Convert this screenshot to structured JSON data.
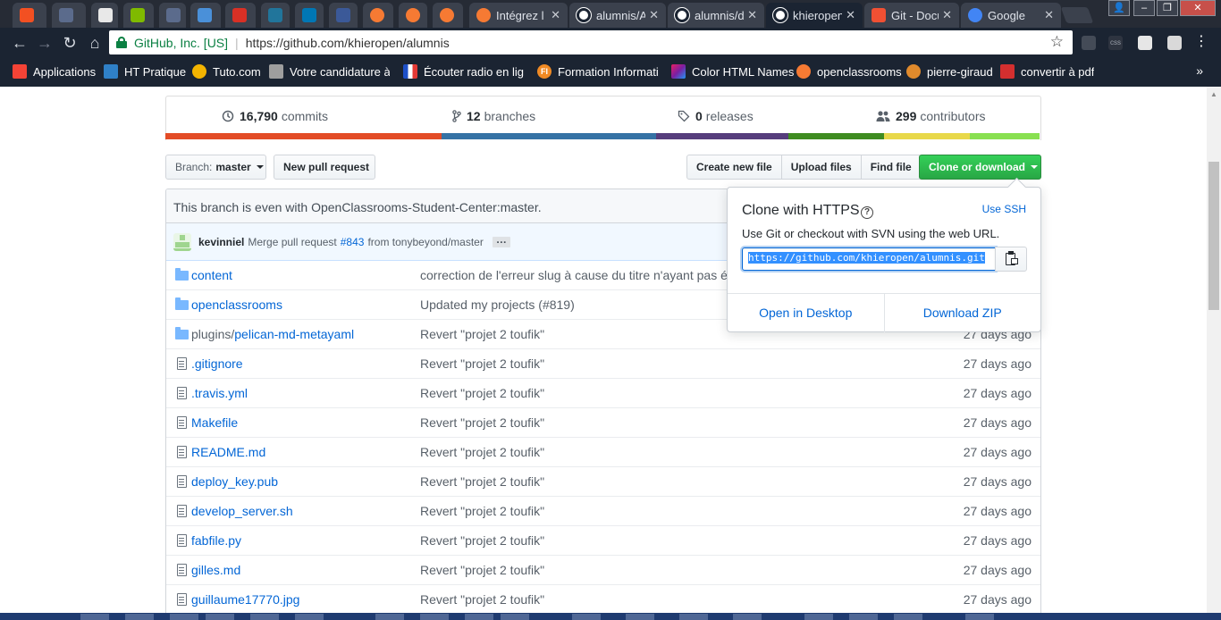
{
  "browser": {
    "tabs": [
      {
        "icon": "microsoft-icon",
        "label": "",
        "color": "#f25022"
      },
      {
        "icon": "settings-icon",
        "label": "",
        "color": "#5b6b8c"
      },
      {
        "icon": "text-icon",
        "label": "",
        "color": "#e8e8e8"
      },
      {
        "icon": "microsoft-icon",
        "label": "",
        "color": "#7fba00"
      },
      {
        "icon": "refresh-icon",
        "label": "",
        "color": "#5b6b8c"
      },
      {
        "icon": "kr-icon",
        "label": "",
        "color": "#4a90d9"
      },
      {
        "icon": "gmail-icon",
        "label": "",
        "color": "#d93025"
      },
      {
        "icon": "wordpress-icon",
        "label": "",
        "color": "#21759b"
      },
      {
        "icon": "linkedin-icon",
        "label": "",
        "color": "#0077b5"
      },
      {
        "icon": "facebook-icon",
        "label": "",
        "color": "#3b5998"
      },
      {
        "icon": "openclassrooms-icon",
        "label": "",
        "color": "#f67a33"
      },
      {
        "icon": "openclassrooms-icon",
        "label": "",
        "color": "#f67a33"
      },
      {
        "icon": "openclassrooms-icon",
        "label": "",
        "color": "#f67a33"
      },
      {
        "icon": "openclassrooms-icon",
        "label": "Intégrez l",
        "color": "#f67a33"
      },
      {
        "icon": "github-icon",
        "label": "alumnis/A",
        "color": "#ffffff"
      },
      {
        "icon": "github-icon",
        "label": "alumnis/d",
        "color": "#ffffff"
      },
      {
        "icon": "github-icon",
        "label": "khieropen",
        "color": "#ffffff"
      },
      {
        "icon": "git-icon",
        "label": "Git - Docu",
        "color": "#f05033"
      },
      {
        "icon": "google-icon",
        "label": "Google",
        "color": "#4285f4"
      }
    ],
    "active_tab_index": 16,
    "secure_org": "GitHub, Inc. [US]",
    "url_separator": "|",
    "url": "https://github.com/khieropen/alumnis",
    "bookmarks": [
      {
        "icon": "apps-grid-icon",
        "label": "Applications",
        "color": "#f44336"
      },
      {
        "icon": "ht-pratique-icon",
        "label": "HT Pratique",
        "color": "#2f80c7"
      },
      {
        "icon": "tuto-icon",
        "label": "Tuto.com",
        "color": "#f4b400"
      },
      {
        "icon": "document-icon",
        "label": "Votre candidature à l'",
        "color": "#9e9e9e"
      },
      {
        "icon": "france-flag-icon",
        "label": "Écouter radio en ligne",
        "color": "#1e50c8"
      },
      {
        "icon": "fi-icon",
        "label": "Formation Informatiq",
        "color": "#f08a24"
      },
      {
        "icon": "color-html-icon",
        "label": "Color HTML Names",
        "color": "#7b1fa2"
      },
      {
        "icon": "openclassrooms-icon",
        "label": "openclassrooms",
        "color": "#f67a33"
      },
      {
        "icon": "pierre-giraud-icon",
        "label": "pierre-giraud",
        "color": "#e08a2c"
      },
      {
        "icon": "pdf-icon",
        "label": "convertir à pdf",
        "color": "#d32f2f"
      }
    ],
    "bookmarks_more": "»"
  },
  "repo": {
    "stats": {
      "commits_count": "16,790",
      "commits_label": "commits",
      "branches_count": "12",
      "branches_label": "branches",
      "releases_count": "0",
      "releases_label": "releases",
      "contributors_count": "299",
      "contributors_label": "contributors"
    },
    "language_bar": [
      {
        "color": "#e34c26",
        "share": 0.315
      },
      {
        "color": "#3572a5",
        "share": 0.245
      },
      {
        "color": "#563d7c",
        "share": 0.151
      },
      {
        "color": "#3f8c21",
        "share": 0.109
      },
      {
        "color": "#e8d84a",
        "share": 0.098
      },
      {
        "color": "#89e051",
        "share": 0.08
      }
    ],
    "branch_prefix": "Branch:",
    "branch_name": "master",
    "new_pull_request": "New pull request",
    "create_new_file": "Create new file",
    "upload_files": "Upload files",
    "find_file": "Find file",
    "clone_or_download": "Clone or download",
    "branch_status": "This branch is even with OpenClassrooms-Student-Center:master.",
    "latest_commit": {
      "author": "kevinniel",
      "message_prefix": "Merge pull request",
      "pr_link": "#843",
      "message_suffix": "from tonybeyond/master",
      "ellipsis": "…"
    },
    "files": [
      {
        "type": "dir",
        "prefix": "",
        "name": "content",
        "message": "correction de l'erreur slug à cause du titre n'ayant pas é",
        "age": ""
      },
      {
        "type": "dir",
        "prefix": "",
        "name": "openclassrooms",
        "message": "Updated my projects (#819)",
        "age": ""
      },
      {
        "type": "dir",
        "prefix": "plugins/",
        "name": "pelican-md-metayaml",
        "message": "Revert \"projet 2 toufik\"",
        "age": "27 days ago"
      },
      {
        "type": "file",
        "prefix": "",
        "name": ".gitignore",
        "message": "Revert \"projet 2 toufik\"",
        "age": "27 days ago"
      },
      {
        "type": "file",
        "prefix": "",
        "name": ".travis.yml",
        "message": "Revert \"projet 2 toufik\"",
        "age": "27 days ago"
      },
      {
        "type": "file",
        "prefix": "",
        "name": "Makefile",
        "message": "Revert \"projet 2 toufik\"",
        "age": "27 days ago"
      },
      {
        "type": "file",
        "prefix": "",
        "name": "README.md",
        "message": "Revert \"projet 2 toufik\"",
        "age": "27 days ago"
      },
      {
        "type": "file",
        "prefix": "",
        "name": "deploy_key.pub",
        "message": "Revert \"projet 2 toufik\"",
        "age": "27 days ago"
      },
      {
        "type": "file",
        "prefix": "",
        "name": "develop_server.sh",
        "message": "Revert \"projet 2 toufik\"",
        "age": "27 days ago"
      },
      {
        "type": "file",
        "prefix": "",
        "name": "fabfile.py",
        "message": "Revert \"projet 2 toufik\"",
        "age": "27 days ago"
      },
      {
        "type": "file",
        "prefix": "",
        "name": "gilles.md",
        "message": "Revert \"projet 2 toufik\"",
        "age": "27 days ago"
      },
      {
        "type": "file",
        "prefix": "",
        "name": "guillaume17770.jpg",
        "message": "Revert \"projet 2 toufik\"",
        "age": "27 days ago"
      }
    ]
  },
  "clone_popover": {
    "title": "Clone with HTTPS",
    "help": "?",
    "use_ssh": "Use SSH",
    "description": "Use Git or checkout with SVN using the web URL.",
    "url": "https://github.com/khieropen/alumnis.git",
    "open_in_desktop": "Open in Desktop",
    "download_zip": "Download ZIP"
  }
}
